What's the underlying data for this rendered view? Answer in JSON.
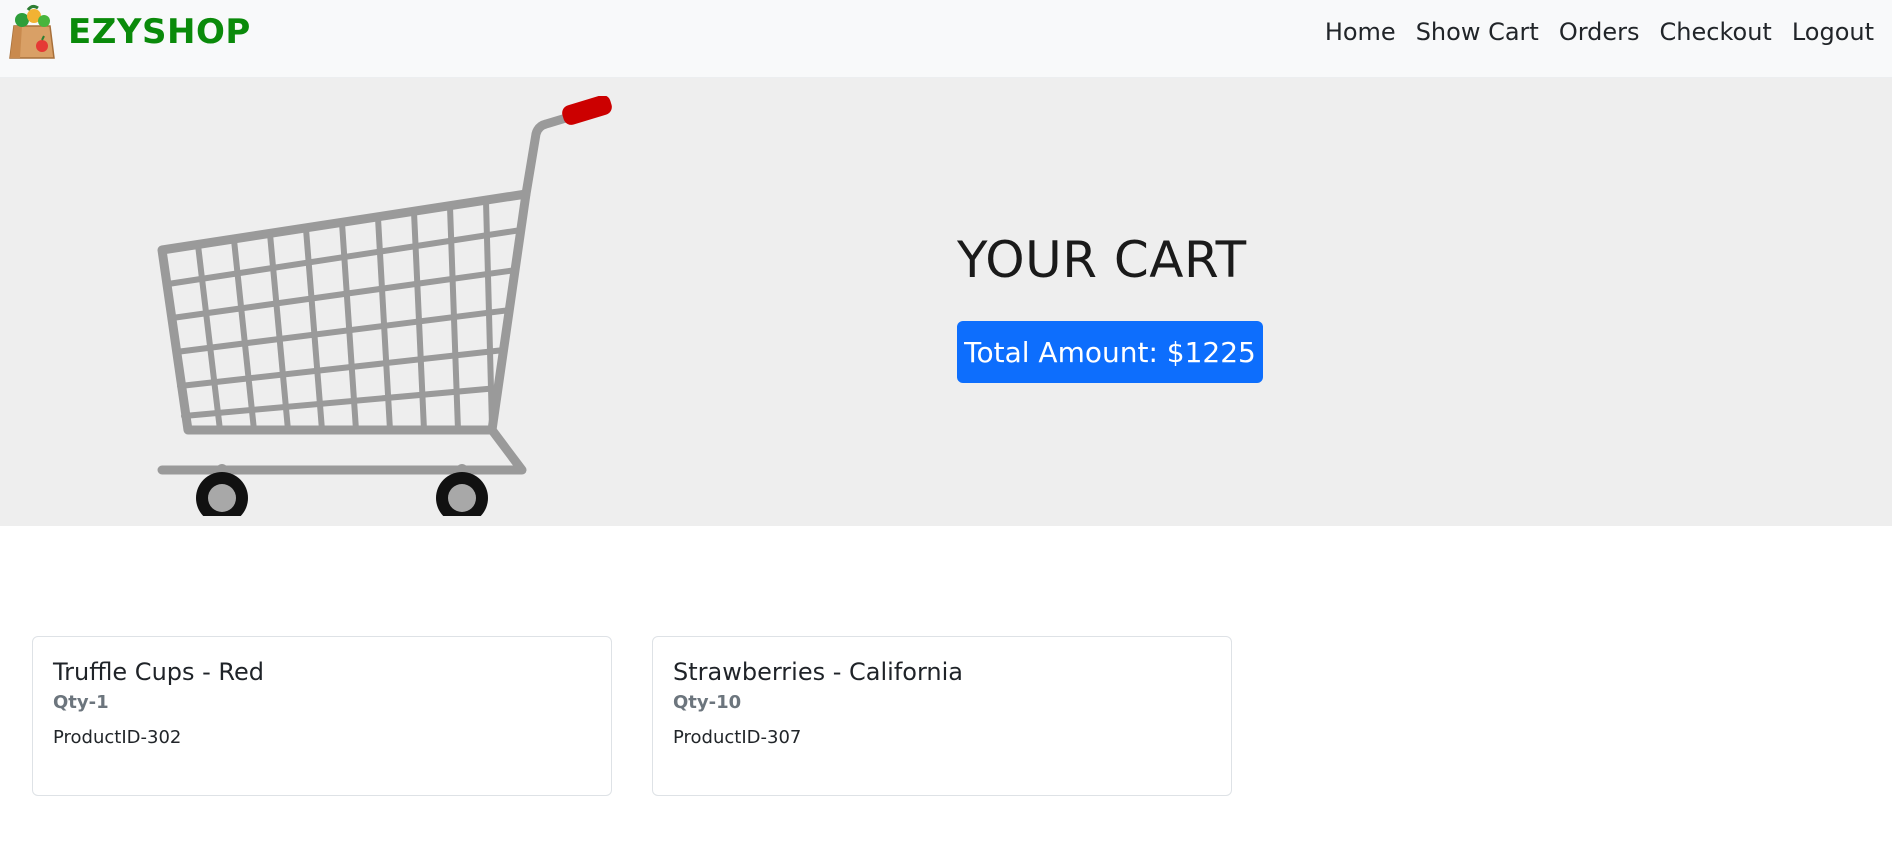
{
  "brand": {
    "name": "EZYSHOP",
    "logo_icon": "shopping-bag-icon"
  },
  "nav": {
    "items": [
      {
        "label": "Home"
      },
      {
        "label": "Show Cart"
      },
      {
        "label": "Orders"
      },
      {
        "label": "Checkout"
      },
      {
        "label": "Logout"
      }
    ]
  },
  "hero": {
    "title": "YOUR CART",
    "total_label": "Total Amount: $1225",
    "image_icon": "shopping-cart-icon"
  },
  "cart_items": [
    {
      "name": "Truffle Cups - Red",
      "qty": "Qty-1",
      "product_id": "ProductID-302"
    },
    {
      "name": "Strawberries - California",
      "qty": "Qty-10",
      "product_id": "ProductID-307"
    }
  ],
  "colors": {
    "brand": "#0a8a0a",
    "primary": "#0d6efd",
    "hero_bg": "#eeeeee",
    "navbar_bg": "#f8f9fa"
  }
}
